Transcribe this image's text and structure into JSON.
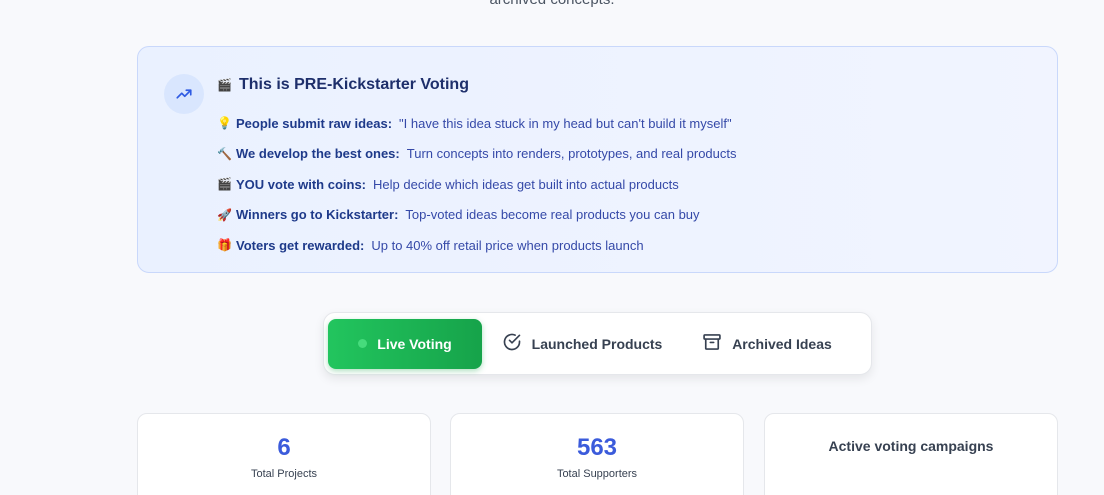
{
  "header": {
    "cut_text": "archived concepts."
  },
  "info": {
    "title_icon": "clapper-board",
    "title": "This is PRE-Kickstarter Voting",
    "items": [
      {
        "emoji": "💡",
        "emoji_name": "lightbulb-icon",
        "bold": "People submit raw ideas:",
        "desc": "\"I have this idea stuck in my head but can't build it myself\""
      },
      {
        "emoji": "🔨",
        "emoji_name": "hammer-icon",
        "bold": "We develop the best ones:",
        "desc": "Turn concepts into renders, prototypes, and real products"
      },
      {
        "emoji": "🎬",
        "emoji_name": "clapper-icon",
        "bold": "YOU vote with coins:",
        "desc": "Help decide which ideas get built into actual products"
      },
      {
        "emoji": "🚀",
        "emoji_name": "rocket-icon",
        "bold": "Winners go to Kickstarter:",
        "desc": "Top-voted ideas become real products you can buy"
      },
      {
        "emoji": "🎁",
        "emoji_name": "gift-icon",
        "bold": "Voters get rewarded:",
        "desc": "Up to 40% off retail price when products launch"
      }
    ]
  },
  "tabs": {
    "live": "Live Voting",
    "launched": "Launched Products",
    "archived": "Archived Ideas",
    "active": "live"
  },
  "stats": [
    {
      "value": "6",
      "label": "Total Projects"
    },
    {
      "value": "563",
      "label": "Total Supporters"
    },
    {
      "heading": "Active voting campaigns"
    }
  ],
  "colors": {
    "accent_blue": "#3b5bdb",
    "live_green": "#22c55e",
    "info_bg": "#eef3ff"
  }
}
